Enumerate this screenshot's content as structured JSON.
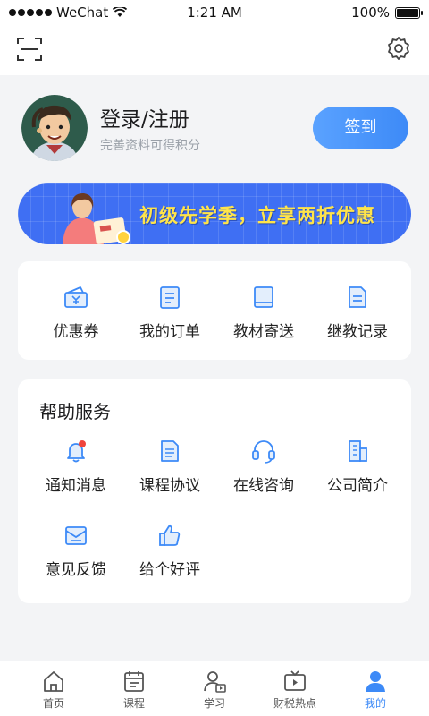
{
  "status_bar": {
    "carrier": "WeChat",
    "time": "1:21 AM",
    "battery": "100%"
  },
  "profile": {
    "title": "登录/注册",
    "subtitle": "完善资料可得积分",
    "checkin_label": "签到"
  },
  "banner": {
    "text": "初级先学季，立享两折优惠"
  },
  "quick_menu": [
    {
      "label": "优惠券",
      "icon": "coupon-icon"
    },
    {
      "label": "我的订单",
      "icon": "order-icon"
    },
    {
      "label": "教材寄送",
      "icon": "book-icon"
    },
    {
      "label": "继教记录",
      "icon": "record-icon"
    }
  ],
  "help": {
    "title": "帮助服务",
    "items": [
      {
        "label": "通知消息",
        "icon": "bell-icon"
      },
      {
        "label": "课程协议",
        "icon": "document-icon"
      },
      {
        "label": "在线咨询",
        "icon": "headset-icon"
      },
      {
        "label": "公司简介",
        "icon": "building-icon"
      },
      {
        "label": "意见反馈",
        "icon": "mail-icon"
      },
      {
        "label": "给个好评",
        "icon": "thumbs-up-icon"
      }
    ]
  },
  "tabs": [
    {
      "label": "首页",
      "icon": "home-icon"
    },
    {
      "label": "课程",
      "icon": "calendar-icon"
    },
    {
      "label": "学习",
      "icon": "study-icon"
    },
    {
      "label": "财税热点",
      "icon": "tv-icon"
    },
    {
      "label": "我的",
      "icon": "user-icon",
      "active": true
    }
  ],
  "colors": {
    "accent": "#3d8af7",
    "banner_bg": "#3f6ff3",
    "banner_text": "#ffe44a",
    "notify_dot": "#f0443c"
  }
}
